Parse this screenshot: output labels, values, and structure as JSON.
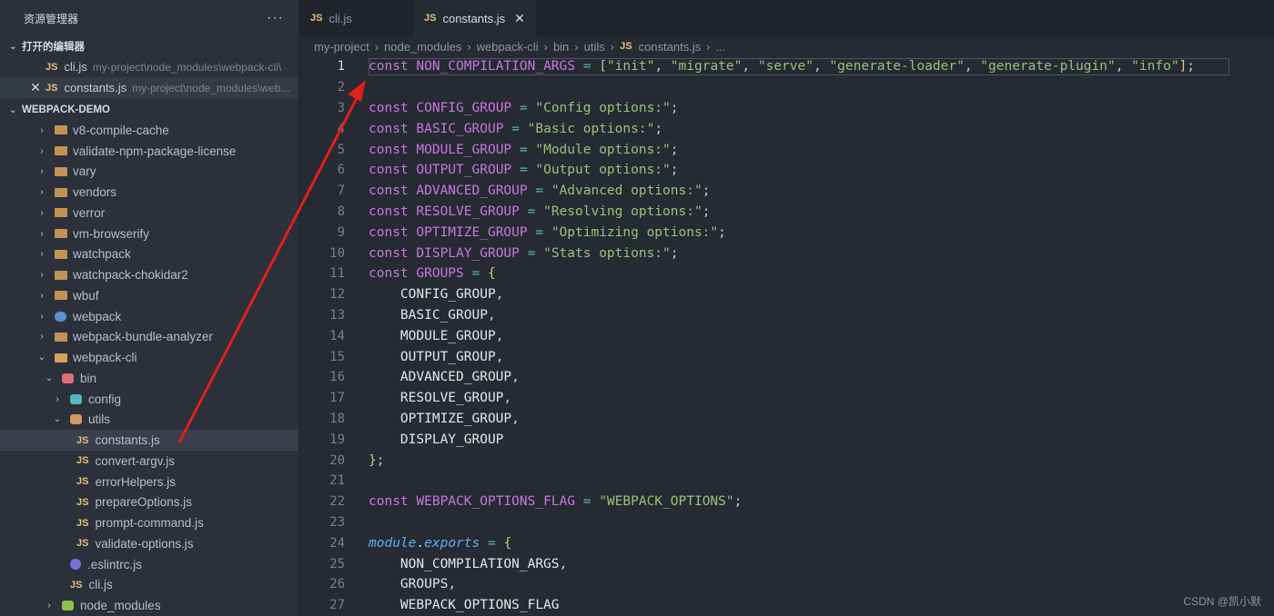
{
  "sidebar": {
    "title": "资源管理器",
    "more_label": "···",
    "open_editors_title": "打开的编辑器",
    "open_editors": [
      {
        "name": "cli.js",
        "path": "my-project\\node_modules\\webpack-cli\\",
        "lang": "JS"
      },
      {
        "name": "constants.js",
        "path": "my-project\\node_modules\\web...",
        "lang": "JS",
        "close": "✕"
      }
    ],
    "project_title": "WEBPACK-DEMO",
    "tree": [
      {
        "label": "v8-compile-cache",
        "caret": "›"
      },
      {
        "label": "validate-npm-package-license",
        "caret": "›"
      },
      {
        "label": "vary",
        "caret": "›"
      },
      {
        "label": "vendors",
        "caret": "›"
      },
      {
        "label": "verror",
        "caret": "›"
      },
      {
        "label": "vm-browserify",
        "caret": "›"
      },
      {
        "label": "watchpack",
        "caret": "›"
      },
      {
        "label": "watchpack-chokidar2",
        "caret": "›"
      },
      {
        "label": "wbuf",
        "caret": "›"
      },
      {
        "label": "webpack",
        "caret": "›"
      },
      {
        "label": "webpack-bundle-analyzer",
        "caret": "›"
      },
      {
        "label": "webpack-cli",
        "caret": "⌄"
      },
      {
        "label": "bin",
        "caret": "⌄"
      },
      {
        "label": "config",
        "caret": "›"
      },
      {
        "label": "utils",
        "caret": "⌄"
      },
      {
        "label": "constants.js",
        "lang": "JS"
      },
      {
        "label": "convert-argv.js",
        "lang": "JS"
      },
      {
        "label": "errorHelpers.js",
        "lang": "JS"
      },
      {
        "label": "prepareOptions.js",
        "lang": "JS"
      },
      {
        "label": "prompt-command.js",
        "lang": "JS"
      },
      {
        "label": "validate-options.js",
        "lang": "JS"
      },
      {
        "label": ".eslintrc.js"
      },
      {
        "label": "cli.js",
        "lang": "JS"
      },
      {
        "label": "node_modules",
        "caret": "›"
      }
    ]
  },
  "tabs": [
    {
      "label": "cli.js",
      "lang": "JS"
    },
    {
      "label": "constants.js",
      "lang": "JS",
      "close": "✕"
    }
  ],
  "breadcrumb": [
    "my-project",
    "node_modules",
    "webpack-cli",
    "bin",
    "utils",
    "constants.js",
    "..."
  ],
  "breadcrumb_sep": "›",
  "breadcrumb_lang": "JS",
  "editor": {
    "current_line": 1,
    "lines": [
      {
        "n": "1",
        "text": "const NON_COMPILATION_ARGS = [\"init\", \"migrate\", \"serve\", \"generate-loader\", \"generate-plugin\", \"info\"];"
      },
      {
        "n": "2",
        "text": ""
      },
      {
        "n": "3",
        "text": "const CONFIG_GROUP = \"Config options:\";"
      },
      {
        "n": "4",
        "text": "const BASIC_GROUP = \"Basic options:\";"
      },
      {
        "n": "5",
        "text": "const MODULE_GROUP = \"Module options:\";"
      },
      {
        "n": "6",
        "text": "const OUTPUT_GROUP = \"Output options:\";"
      },
      {
        "n": "7",
        "text": "const ADVANCED_GROUP = \"Advanced options:\";"
      },
      {
        "n": "8",
        "text": "const RESOLVE_GROUP = \"Resolving options:\";"
      },
      {
        "n": "9",
        "text": "const OPTIMIZE_GROUP = \"Optimizing options:\";"
      },
      {
        "n": "10",
        "text": "const DISPLAY_GROUP = \"Stats options:\";"
      },
      {
        "n": "11",
        "text": "const GROUPS = {"
      },
      {
        "n": "12",
        "text": "    CONFIG_GROUP,"
      },
      {
        "n": "13",
        "text": "    BASIC_GROUP,"
      },
      {
        "n": "14",
        "text": "    MODULE_GROUP,"
      },
      {
        "n": "15",
        "text": "    OUTPUT_GROUP,"
      },
      {
        "n": "16",
        "text": "    ADVANCED_GROUP,"
      },
      {
        "n": "17",
        "text": "    RESOLVE_GROUP,"
      },
      {
        "n": "18",
        "text": "    OPTIMIZE_GROUP,"
      },
      {
        "n": "19",
        "text": "    DISPLAY_GROUP"
      },
      {
        "n": "20",
        "text": "};"
      },
      {
        "n": "21",
        "text": ""
      },
      {
        "n": "22",
        "text": "const WEBPACK_OPTIONS_FLAG = \"WEBPACK_OPTIONS\";"
      },
      {
        "n": "23",
        "text": ""
      },
      {
        "n": "24",
        "text": "module.exports = {"
      },
      {
        "n": "25",
        "text": "    NON_COMPILATION_ARGS,"
      },
      {
        "n": "26",
        "text": "    GROUPS,"
      },
      {
        "n": "27",
        "text": "    WEBPACK_OPTIONS_FLAG"
      }
    ]
  },
  "watermark": "CSDN @凯小默",
  "colors": {
    "annotation_arrow": "#e0201a",
    "accent_js": "#e5c07b"
  }
}
